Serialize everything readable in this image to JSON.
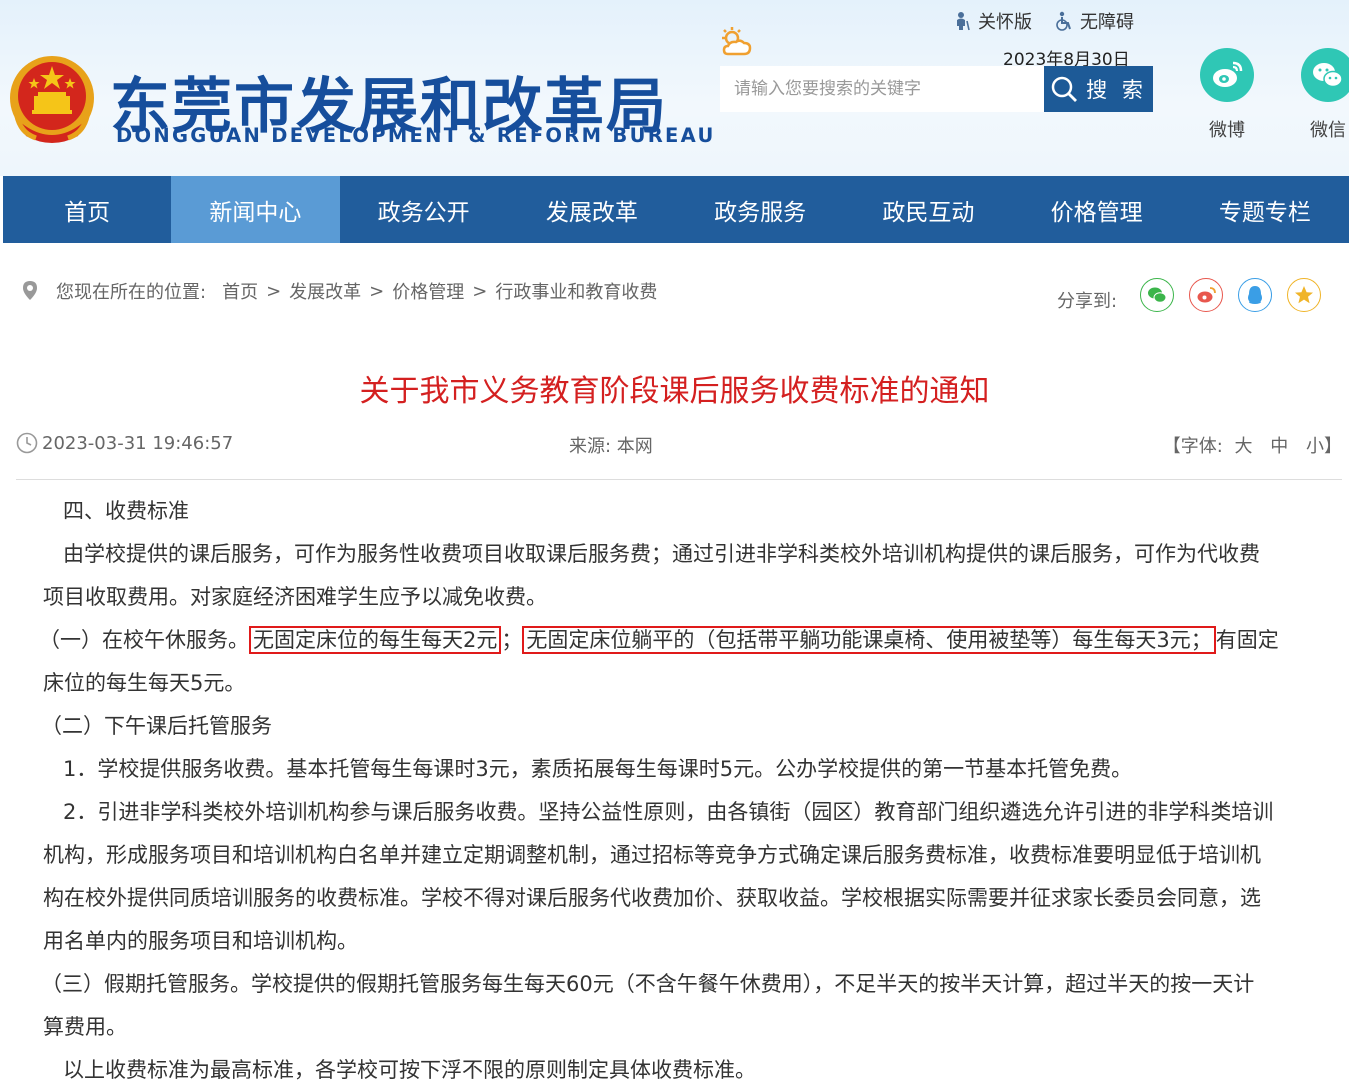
{
  "header": {
    "title_cn": "东莞市发展和改革局",
    "title_en": "DONGGUAN DEVELOPMENT & REFORM BUREAU",
    "care_mode": "关怀版",
    "accessibility": "无障碍",
    "date": "2023年8月30日",
    "search_placeholder": "请输入您要搜索的关键字",
    "search_button": "搜 索",
    "weibo_label": "微博",
    "wechat_label": "微信"
  },
  "nav": {
    "items": [
      "首页",
      "新闻中心",
      "政务公开",
      "发展改革",
      "政务服务",
      "政民互动",
      "价格管理",
      "专题专栏"
    ],
    "active_index": 1
  },
  "breadcrumb": {
    "prefix": "您现在所在的位置:",
    "items": [
      "首页",
      "发展改革",
      "价格管理",
      "行政事业和教育收费"
    ],
    "separator": ">"
  },
  "share": {
    "label": "分享到:"
  },
  "article": {
    "title": "关于我市义务教育阶段课后服务收费标准的通知",
    "datetime": "2023-03-31 19:46:57",
    "source": "来源:  本网",
    "font_label": "【字体:",
    "font_large": "大",
    "font_medium": "中",
    "font_small": "小】",
    "paragraphs": {
      "p1": "四、收费标准",
      "p2a": "由学校提供的课后服务，可作为服务性收费项目收取课后服务费；通过引进非学科类校外培训机构提供的课后服务，可作为代收费",
      "p2b": "项目收取费用。对家庭经济困难学生应予以减免收费。",
      "p3_pre": "（一）在校午休服务。",
      "p3_hl1": "无固定床位的每生每天2元",
      "p3_sep": "；",
      "p3_hl2": "无固定床位躺平的（包括带平躺功能课桌椅、使用被垫等）每生每天3元；",
      "p3_post": "有固定",
      "p3b": "床位的每生每天5元。",
      "p4": "（二）下午课后托管服务",
      "p5": "1．学校提供服务收费。基本托管每生每课时3元，素质拓展每生每课时5元。公办学校提供的第一节基本托管免费。",
      "p6a": "2．引进非学科类校外培训机构参与课后服务收费。坚持公益性原则，由各镇街（园区）教育部门组织遴选允许引进的非学科类培训",
      "p6b": "机构，形成服务项目和培训机构白名单并建立定期调整机制，通过招标等竞争方式确定课后服务费标准，收费标准要明显低于培训机",
      "p6c": "构在校外提供同质培训服务的收费标准。学校不得对课后服务代收费加价、获取收益。学校根据实际需要并征求家长委员会同意，选",
      "p6d": "用名单内的服务项目和培训机构。",
      "p7a": "（三）假期托管服务。学校提供的假期托管服务每生每天60元（不含午餐午休费用），不足半天的按半天计算，超过半天的按一天计",
      "p7b": "算费用。",
      "p8": "以上收费标准为最高标准，各学校可按下浮不限的原则制定具体收费标准。"
    }
  },
  "colors": {
    "nav_bg": "#215d9c",
    "nav_active": "#5a9bd5",
    "title_red": "#d42020",
    "highlight_border": "#e01a1a",
    "brand_blue": "#164e9c",
    "social_teal": "#2fc7b5"
  }
}
